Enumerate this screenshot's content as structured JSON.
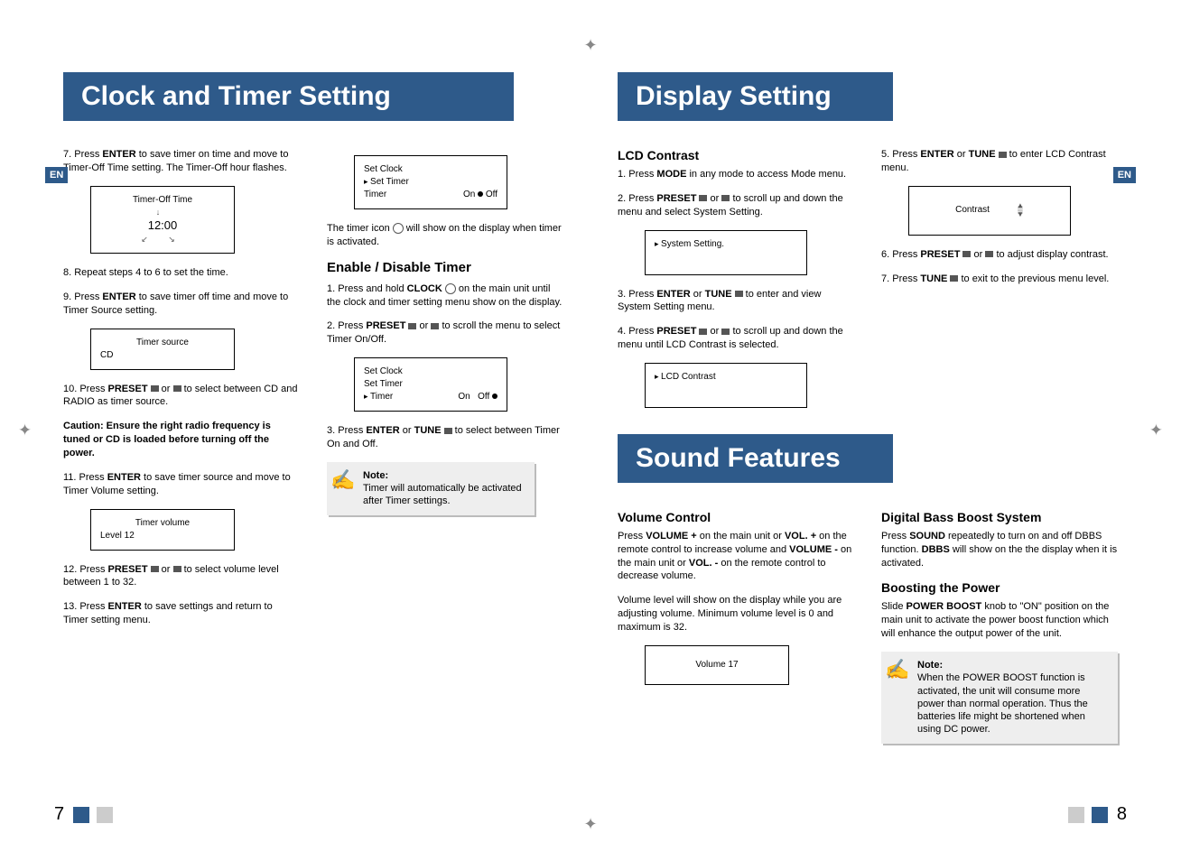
{
  "left": {
    "header": "Clock and Timer Setting",
    "en": "EN",
    "colA": {
      "s7a": "7. Press ",
      "s7b": "ENTER",
      "s7c": " to save timer on time and move to Timer-Off Time setting.  The Timer-Off hour flashes.",
      "box7_title": "Timer-Off Time",
      "box7_time": "12:00",
      "s8": "8. Repeat steps 4 to 6 to set the time.",
      "s9a": "9. Press ",
      "s9b": "ENTER",
      "s9c": " to save timer off time and move to Timer Source setting.",
      "box9_title": "Timer source",
      "box9_val": "CD",
      "s10a": "10.  Press ",
      "s10b": "PRESET ",
      "s10c": " or ",
      "s10d": " to select between CD and RADIO as timer source.",
      "caution": "Caution:  Ensure the right radio frequency is tuned or CD is loaded before turning off the power.",
      "s11a": "11. Press ",
      "s11b": "ENTER",
      "s11c": " to save timer source and move to Timer Volume  setting.",
      "box11_title": "Timer volume",
      "box11_val": "Level     12",
      "s12a": "12.  Press ",
      "s12b": "PRESET ",
      "s12c": " or ",
      "s12d": " to select volume level between 1 to 32.",
      "s13a": "13. Press ",
      "s13b": "ENTER",
      "s13c": "  to save settings and return to Timer setting menu."
    },
    "colB": {
      "box_menu_l1": "Set Clock",
      "box_menu_l2": "Set Timer",
      "box_menu_l3a": "Timer",
      "box_menu_l3b": "On",
      "box_menu_l3c": "Off",
      "afterbox_a": "The timer icon ",
      "afterbox_b": " will show on the display when timer is activated.",
      "h2": "Enable / Disable Timer",
      "e1a": "1. Press and hold ",
      "e1b": "CLOCK ",
      "e1c": " on the main unit until the clock and timer setting menu show on the display.",
      "e2a": "2. Press ",
      "e2b": "PRESET ",
      "e2c": " or ",
      "e2d": " to scroll the menu to select Timer On/Off.",
      "box2_l1": "Set Clock",
      "box2_l2": "Set Timer",
      "box2_l3a": "Timer",
      "box2_l3b": "On",
      "box2_l3c": "Off",
      "e3a": "3.  Press ",
      "e3b": "ENTER",
      "e3c": " or ",
      "e3d": "TUNE ",
      "e3e": " to select between Timer On and  Off.",
      "note_title": "Note:",
      "note_body": "Timer will automatically be activated after Timer settings."
    },
    "pagenum": "7"
  },
  "right": {
    "header1": "Display Setting",
    "en": "EN",
    "lcd": {
      "h3": "LCD Contrast",
      "s1a": "1.  Press ",
      "s1b": "MODE",
      "s1c": "  in any mode to access Mode menu.",
      "s2a": "2.  Press ",
      "s2b": "PRESET ",
      "s2c": " or ",
      "s2d": " to scroll up and down the menu and select System Setting.",
      "box2": "System Setting.",
      "s3a": "3.  Press ",
      "s3b": "ENTER",
      "s3c": " or ",
      "s3d": "TUNE ",
      "s3e": " to enter and view System Setting  menu.",
      "s4a": "4.  Press ",
      "s4b": "PRESET ",
      "s4c": " or ",
      "s4d": " to scroll up and down the menu  until LCD Contrast is selected.",
      "box4": "LCD Contrast",
      "s5a": "5.  Press ",
      "s5b": "ENTER",
      "s5c": " or ",
      "s5d": "TUNE ",
      "s5e": " to enter LCD Contrast menu.",
      "box5": "Contrast",
      "s6a": "6. Press ",
      "s6b": "PRESET ",
      "s6c": " or ",
      "s6d": " to adjust display contrast.",
      "s7a": "7. Press ",
      "s7b": "TUNE ",
      "s7c": " to exit to the previous menu level."
    },
    "header2": "Sound Features",
    "sound": {
      "vc_h3": "Volume Control",
      "vc_a": "Press ",
      "vc_b": "VOLUME  +",
      "vc_c": " on the main unit or ",
      "vc_d": "VOL.  +",
      "vc_e": " on the remote control to increase volume and ",
      "vc_f": "VOLUME  -",
      "vc_g": " on the main unit or ",
      "vc_h": "VOL.  -",
      "vc_i": " on the remote control to decrease  volume.",
      "vc_j": "Volume  level will show on the display while you are adjusting volume.  Minimum volume level is 0 and maximum is 32.",
      "vc_box": "Volume 17",
      "db_h3": "Digital Bass Boost System",
      "db_a": "Press ",
      "db_b": "SOUND",
      "db_c": " repeatedly to turn on and off DBBS function.  ",
      "db_d": "DBBS",
      "db_e": " will show on the the display when it is activated.",
      "bp_h3": "Boosting the Power",
      "bp_a": "Slide ",
      "bp_b": "POWER BOOST",
      "bp_c": " knob to \"ON\" position on the main unit to activate the power boost function which will enhance the output power of the unit.",
      "note_title": "Note:",
      "note_body": "When the POWER BOOST function is activated, the unit will consume more power than normal operation. Thus the batteries life might be shortened when using DC power."
    },
    "pagenum": "8"
  }
}
